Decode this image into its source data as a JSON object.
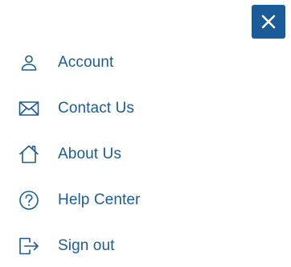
{
  "colors": {
    "accent": "#1a5c9a",
    "background": "#ffffff",
    "close_icon": "#ffffff"
  },
  "close_button": {
    "icon": "close-icon"
  },
  "menu": {
    "items": [
      {
        "label": "Account",
        "icon": "user-icon"
      },
      {
        "label": "Contact Us",
        "icon": "envelope-icon"
      },
      {
        "label": "About Us",
        "icon": "home-icon"
      },
      {
        "label": "Help Center",
        "icon": "help-icon"
      },
      {
        "label": "Sign out",
        "icon": "sign-out-icon"
      }
    ]
  }
}
